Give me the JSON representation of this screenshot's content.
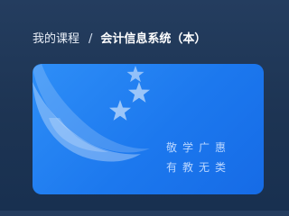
{
  "breadcrumb": {
    "parent": "我的课程",
    "separator": "/",
    "current": "会计信息系统（本）"
  },
  "course_card": {
    "motto_line1": "敬学广惠",
    "motto_line2": "有教无类",
    "colors": {
      "card_blue": "#2380F2",
      "background_navy": "#1D3453"
    }
  }
}
